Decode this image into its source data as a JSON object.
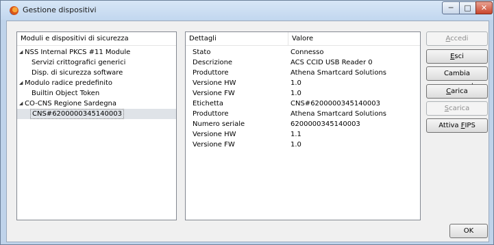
{
  "window": {
    "title": "Gestione dispositivi",
    "controls": {
      "minimize": "─",
      "maximize": "□",
      "close": "✕"
    }
  },
  "left_panel": {
    "header": "Moduli e dispositivi di sicurezza",
    "tree": [
      {
        "label": "NSS Internal PKCS #11 Module",
        "level": 0,
        "expanded": true
      },
      {
        "label": "Servizi crittografici generici",
        "level": 1
      },
      {
        "label": "Disp. di sicurezza software",
        "level": 1
      },
      {
        "label": "Modulo radice predefinito",
        "level": 0,
        "expanded": true
      },
      {
        "label": "Builtin Object Token",
        "level": 1
      },
      {
        "label": "CO-CNS Regione Sardegna",
        "level": 0,
        "expanded": true
      },
      {
        "label": "CNS#6200000345140003",
        "level": 1,
        "selected": true
      }
    ]
  },
  "right_panel": {
    "headers": {
      "details": "Dettagli",
      "value": "Valore"
    },
    "rows": [
      {
        "key": "Stato",
        "value": "Connesso"
      },
      {
        "key": "Descrizione",
        "value": "ACS CCID USB Reader 0"
      },
      {
        "key": "Produttore",
        "value": "Athena Smartcard Solutions"
      },
      {
        "key": "Versione HW",
        "value": "1.0"
      },
      {
        "key": "Versione FW",
        "value": "1.0"
      },
      {
        "key": "Etichetta",
        "value": "CNS#6200000345140003"
      },
      {
        "key": "Produttore",
        "value": "Athena Smartcard Solutions"
      },
      {
        "key": "Numero seriale",
        "value": "6200000345140003"
      },
      {
        "key": "Versione HW",
        "value": "1.1"
      },
      {
        "key": "Versione FW",
        "value": "1.0"
      }
    ]
  },
  "buttons": {
    "accedi": {
      "pre": "",
      "u": "A",
      "post": "ccedi",
      "enabled": false
    },
    "esci": {
      "pre": "",
      "u": "E",
      "post": "sci",
      "enabled": true
    },
    "cambia_password": {
      "pre": "Cambia ",
      "u": "p",
      "post": "assword",
      "enabled": true
    },
    "carica": {
      "pre": "",
      "u": "C",
      "post": "arica",
      "enabled": true
    },
    "scarica": {
      "pre": "",
      "u": "S",
      "post": "carica",
      "enabled": false
    },
    "attiva_fips": {
      "pre": "Attiva ",
      "u": "F",
      "post": "IPS",
      "enabled": true
    },
    "ok": {
      "label": "OK",
      "enabled": true
    }
  }
}
